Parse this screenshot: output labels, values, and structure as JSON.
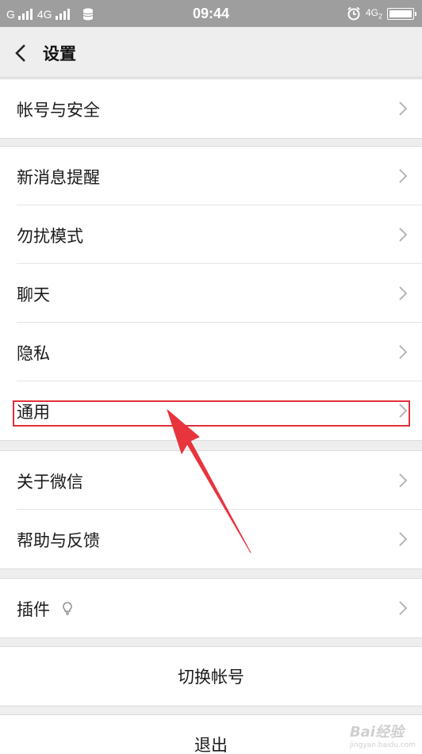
{
  "status_bar": {
    "carrier1": "G",
    "carrier2": "4G",
    "time": "09:44",
    "network_right": "4G",
    "network_sub": "2",
    "battery_level": 1.0
  },
  "header": {
    "title": "设置",
    "back_icon": "chevron-left-icon"
  },
  "groups": [
    {
      "items": [
        {
          "label": "帐号与安全"
        }
      ]
    },
    {
      "items": [
        {
          "label": "新消息提醒"
        },
        {
          "label": "勿扰模式"
        },
        {
          "label": "聊天"
        },
        {
          "label": "隐私"
        },
        {
          "label": "通用"
        }
      ]
    },
    {
      "items": [
        {
          "label": "关于微信"
        },
        {
          "label": "帮助与反馈"
        }
      ]
    },
    {
      "items": [
        {
          "label": "插件",
          "icon": "lightbulb-icon"
        }
      ]
    }
  ],
  "buttons": {
    "switch_account": "切换帐号",
    "logout": "退出"
  },
  "annotation": {
    "highlight_color": "#e0303a",
    "highlighted_item": "通用"
  },
  "watermark": {
    "text": "Bai经验",
    "sub": "jingyan.baidu.com"
  }
}
